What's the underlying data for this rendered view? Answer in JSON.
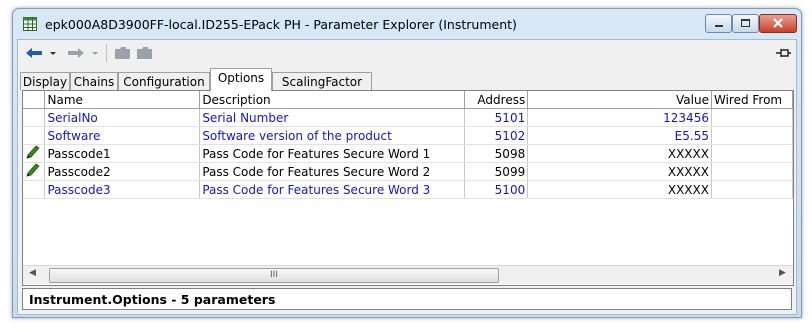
{
  "window": {
    "title": "epk000A8D3900FF-local.ID255-EPack  PH - Parameter Explorer (Instrument)"
  },
  "toolbar": {
    "back_icon": "back-arrow-icon",
    "forward_icon": "forward-arrow-icon",
    "folder_icons": [
      "folder-icon",
      "folder-icon"
    ],
    "pin_icon": "pin-icon"
  },
  "tabs": [
    {
      "label": "Display",
      "active": false
    },
    {
      "label": "Chains",
      "active": false
    },
    {
      "label": "Configuration",
      "active": false
    },
    {
      "label": "Options",
      "active": true
    },
    {
      "label": "ScalingFactor",
      "active": false
    }
  ],
  "grid": {
    "columns": {
      "name": "Name",
      "description": "Description",
      "address": "Address",
      "value": "Value",
      "wired_from": "Wired From"
    },
    "rows": [
      {
        "icon": "",
        "name": "SerialNo",
        "description": "Serial Number",
        "address": "5101",
        "value": "123456",
        "wired_from": "",
        "blue": true
      },
      {
        "icon": "",
        "name": "Software",
        "description": "Software version of the product",
        "address": "5102",
        "value": "E5.55",
        "wired_from": "",
        "blue": true
      },
      {
        "icon": "pencil-icon",
        "name": "Passcode1",
        "description": "Pass Code for Features Secure Word 1",
        "address": "5098",
        "value": "XXXXX",
        "wired_from": "",
        "blue": false
      },
      {
        "icon": "pencil-icon",
        "name": "Passcode2",
        "description": "Pass Code for Features Secure Word 2",
        "address": "5099",
        "value": "XXXXX",
        "wired_from": "",
        "blue": false
      },
      {
        "icon": "",
        "name": "Passcode3",
        "description": "Pass Code for Features Secure Word 3",
        "address": "5100",
        "value": "XXXXX",
        "wired_from": "",
        "blue": true
      }
    ]
  },
  "scrollbar": {
    "thumb_glyph": "III"
  },
  "status": {
    "text": "Instrument.Options  -  5 parameters"
  },
  "colors": {
    "link_blue": "#1515c8",
    "icon_blue": "#1c5fb3",
    "pencil_green": "#3a8a1a"
  }
}
